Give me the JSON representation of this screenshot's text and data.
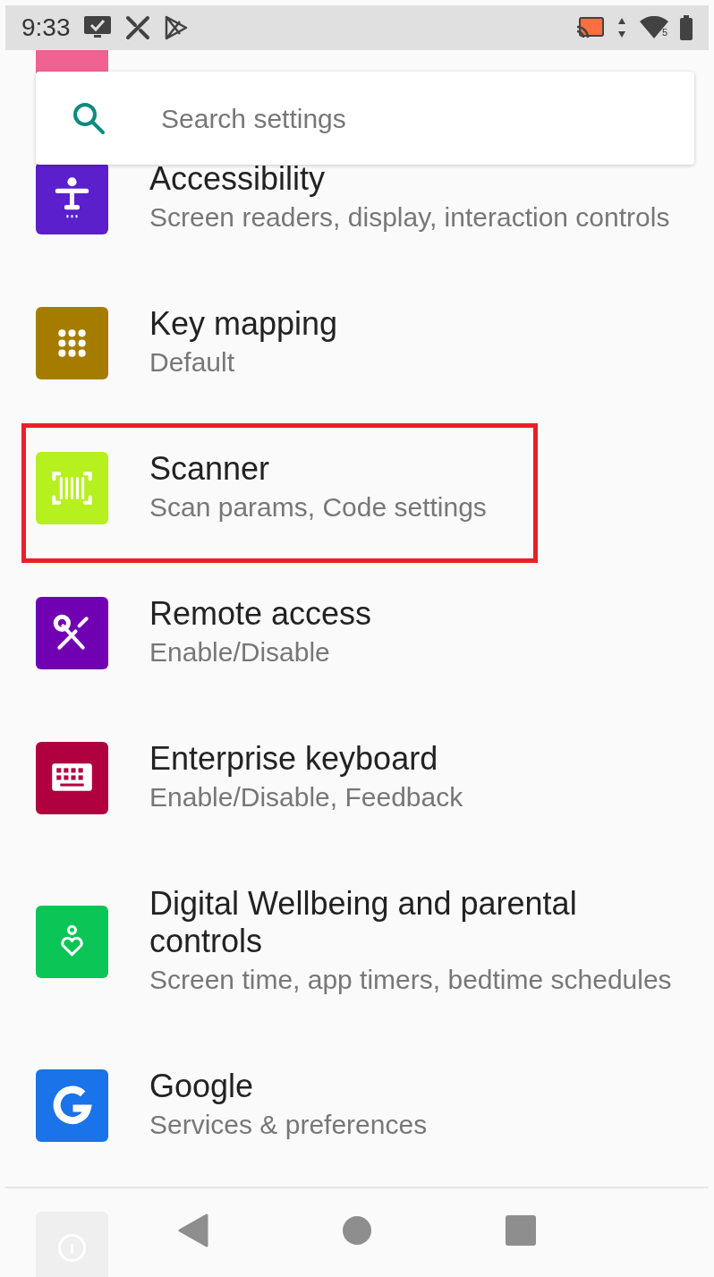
{
  "status_bar": {
    "time": "9:33",
    "wifi_badge": "5"
  },
  "search": {
    "placeholder": "Search settings"
  },
  "items": [
    {
      "kind": "peek",
      "color": "#f06292"
    },
    {
      "kind": "entry",
      "color": "#5b1fcc",
      "title": "Accessibility",
      "subtitle": "Screen readers, display, interaction controls",
      "highlighted": false
    },
    {
      "kind": "entry",
      "color": "#a67c00",
      "title": "Key mapping",
      "subtitle": "Default",
      "highlighted": false
    },
    {
      "kind": "entry",
      "color": "#b6f01e",
      "title": "Scanner",
      "subtitle": "Scan params, Code settings",
      "highlighted": true
    },
    {
      "kind": "entry",
      "color": "#7100b3",
      "title": "Remote access",
      "subtitle": "Enable/Disable",
      "highlighted": false
    },
    {
      "kind": "entry",
      "color": "#b0003f",
      "title": "Enterprise keyboard",
      "subtitle": "Enable/Disable, Feedback",
      "highlighted": false
    },
    {
      "kind": "entry",
      "color": "#0bc556",
      "title": "Digital Wellbeing and parental controls",
      "subtitle": "Screen time, app timers, bedtime schedules",
      "highlighted": false
    },
    {
      "kind": "entry",
      "color": "#1a73e8",
      "title": "Google",
      "subtitle": "Services & preferences",
      "highlighted": false
    },
    {
      "kind": "faded",
      "color": "#efefef"
    }
  ]
}
